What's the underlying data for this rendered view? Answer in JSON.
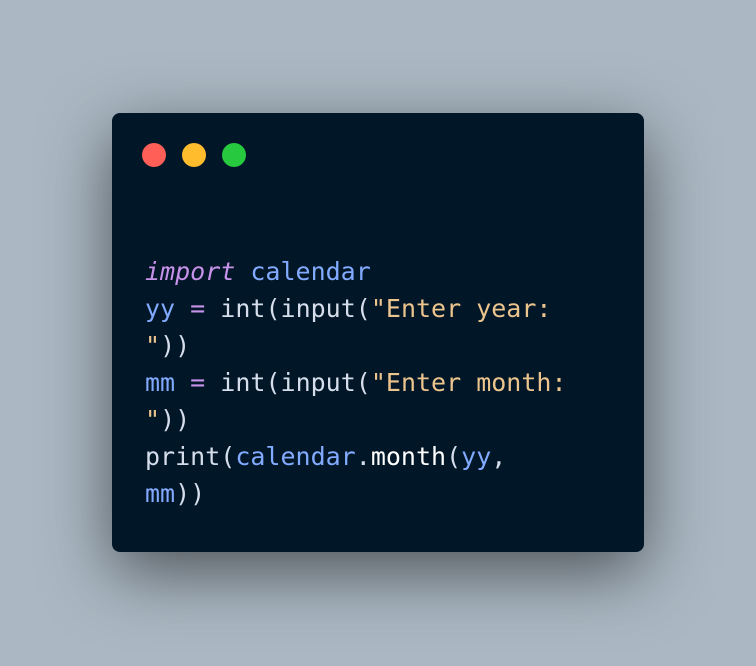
{
  "window": {
    "controls": [
      "close",
      "minimize",
      "maximize"
    ],
    "colors": {
      "background": "#abb8c3",
      "panel": "#011627",
      "close": "#ff5f56",
      "minimize": "#ffbd2e",
      "maximize": "#27c93f"
    }
  },
  "code": {
    "lines": [
      [
        {
          "text": "import",
          "kind": "kw"
        },
        {
          "text": " ",
          "kind": "pn"
        },
        {
          "text": "calendar",
          "kind": "id"
        }
      ],
      [
        {
          "text": "yy",
          "kind": "id"
        },
        {
          "text": " ",
          "kind": "pn"
        },
        {
          "text": "=",
          "kind": "op"
        },
        {
          "text": " ",
          "kind": "pn"
        },
        {
          "text": "int",
          "kind": "fn"
        },
        {
          "text": "(",
          "kind": "pn"
        },
        {
          "text": "input",
          "kind": "fn"
        },
        {
          "text": "(",
          "kind": "pn"
        },
        {
          "text": "\"Enter year:",
          "kind": "str"
        }
      ],
      [
        {
          "text": "\"",
          "kind": "str"
        },
        {
          "text": "))",
          "kind": "pn"
        }
      ],
      [
        {
          "text": "mm",
          "kind": "id"
        },
        {
          "text": " ",
          "kind": "pn"
        },
        {
          "text": "=",
          "kind": "op"
        },
        {
          "text": " ",
          "kind": "pn"
        },
        {
          "text": "int",
          "kind": "fn"
        },
        {
          "text": "(",
          "kind": "pn"
        },
        {
          "text": "input",
          "kind": "fn"
        },
        {
          "text": "(",
          "kind": "pn"
        },
        {
          "text": "\"Enter month:",
          "kind": "str"
        }
      ],
      [
        {
          "text": "\"",
          "kind": "str"
        },
        {
          "text": "))",
          "kind": "pn"
        }
      ],
      [
        {
          "text": "print",
          "kind": "fn"
        },
        {
          "text": "(",
          "kind": "pn"
        },
        {
          "text": "calendar",
          "kind": "id"
        },
        {
          "text": ".",
          "kind": "pn"
        },
        {
          "text": "month",
          "kind": "mem"
        },
        {
          "text": "(",
          "kind": "pn"
        },
        {
          "text": "yy",
          "kind": "id"
        },
        {
          "text": ",",
          "kind": "pn"
        }
      ],
      [
        {
          "text": "mm",
          "kind": "id"
        },
        {
          "text": "))",
          "kind": "pn"
        }
      ]
    ]
  }
}
